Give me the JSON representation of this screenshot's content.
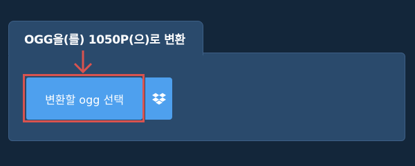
{
  "tab": {
    "title": "OGG을(를) 1050P(으)로 변환"
  },
  "convert_button": {
    "label": "변환할 ogg 선택"
  },
  "dropbox_button": {
    "icon": "dropbox-icon"
  },
  "colors": {
    "page_background": "#13263a",
    "panel_background": "#2a4a6c",
    "button_background": "#4ea0ee",
    "highlight": "#d9534f"
  }
}
